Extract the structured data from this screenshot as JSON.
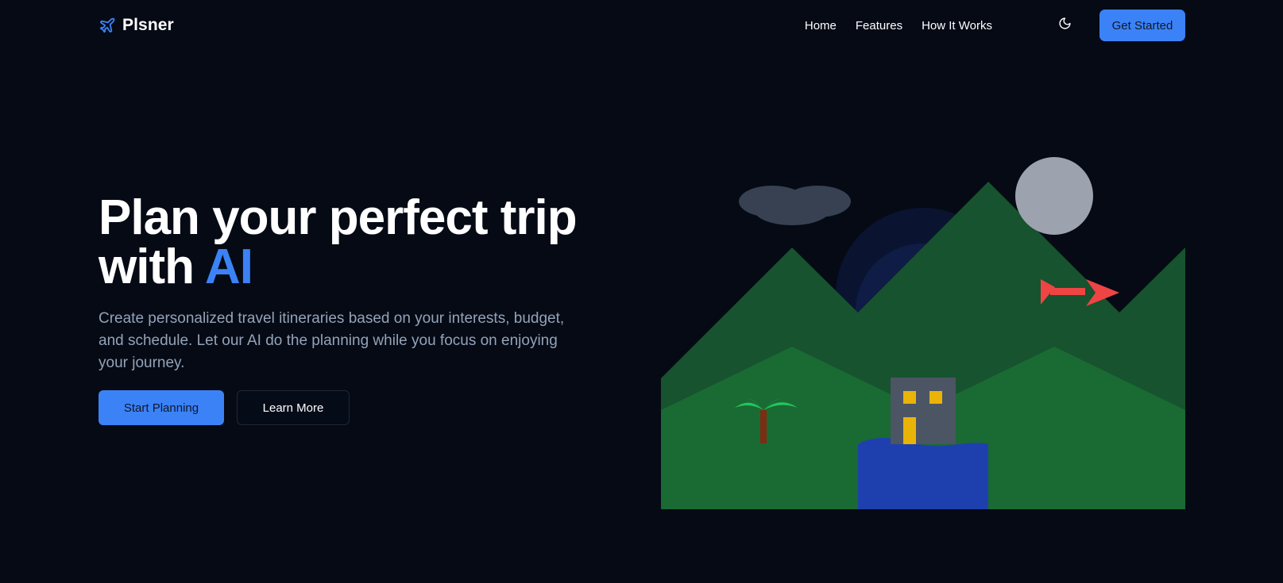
{
  "app": {
    "name": "Plsner",
    "logo_icon": "airplane-icon"
  },
  "nav": {
    "links": [
      {
        "label": "Home"
      },
      {
        "label": "Features"
      },
      {
        "label": "How It Works"
      }
    ],
    "theme_toggle_icon": "moon-icon",
    "cta_label": "Get Started"
  },
  "hero": {
    "title_line1": "Plan your perfect trip",
    "title_line2_prefix": "with",
    "title_accent": "AI",
    "description": "Create personalized travel itineraries based on your interests, budget, and schedule. Let our AI do the planning while you focus on enjoying your journey.",
    "primary_button": "Start Planning",
    "secondary_button": "Learn More"
  },
  "colors": {
    "background": "#050a15",
    "accent": "#3b82f6",
    "mountain_back": "#17532e",
    "mountain_front": "#1a6a34",
    "water": "#1e40af",
    "moon": "#9ca3af",
    "cloud": "#374151",
    "airplane": "#ef4444",
    "house": "#4b5563",
    "window": "#eab308"
  }
}
